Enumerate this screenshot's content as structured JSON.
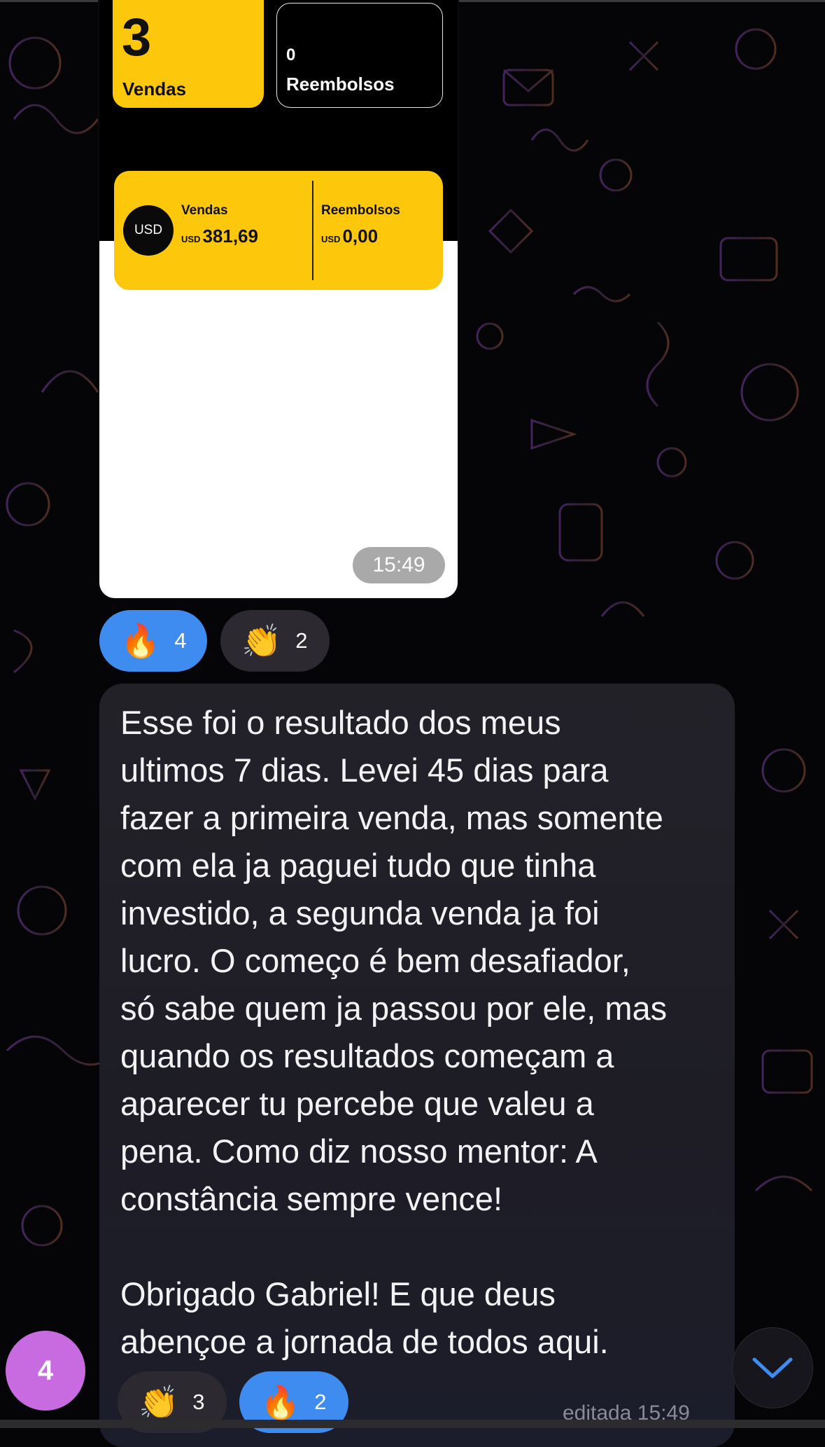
{
  "image_message": {
    "sales_count": "3",
    "sales_label": "Vendas",
    "refunds_count": "0",
    "refunds_label": "Reembolsos",
    "currency_badge": "USD",
    "summary_sales_label": "Vendas",
    "summary_sales_currency": "USD",
    "summary_sales_value": "381,69",
    "summary_refunds_label": "Reembolsos",
    "summary_refunds_currency": "USD",
    "summary_refunds_value": "0,00",
    "time": "15:49"
  },
  "image_reactions": [
    {
      "emoji": "🔥",
      "emoji_name": "fire-emoji",
      "count": "4",
      "active": true
    },
    {
      "emoji": "👏",
      "emoji_name": "clapping-hands-emoji",
      "count": "2",
      "active": false
    }
  ],
  "text_message": {
    "text": "Esse foi o resultado dos meus\nultimos 7 dias. Levei 45 dias para\nfazer a primeira venda, mas somente\ncom ela ja paguei tudo que tinha\ninvestido, a segunda venda ja foi\nlucro. O começo é bem desafiador,\nsó sabe quem ja passou por ele, mas\nquando os resultados começam a\naparecer tu percebe que valeu a\npena. Como diz nosso mentor: A\nconstância sempre vence!\n\nObrigado Gabriel! E que deus\nabençoe a jornada de todos aqui.",
    "time": "editada 15:49"
  },
  "text_reactions": [
    {
      "emoji": "👏",
      "emoji_name": "clapping-hands-emoji",
      "count": "3",
      "active": false
    },
    {
      "emoji": "🔥",
      "emoji_name": "fire-emoji",
      "count": "2",
      "active": true
    }
  ],
  "unread_badge": "4",
  "colors": {
    "accent_blue": "#3f8cf1",
    "badge_purple": "#c86be0",
    "card_yellow": "#fdc80c",
    "background": "#050508"
  },
  "icons": {
    "scroll_down": "chevron-down-icon"
  }
}
